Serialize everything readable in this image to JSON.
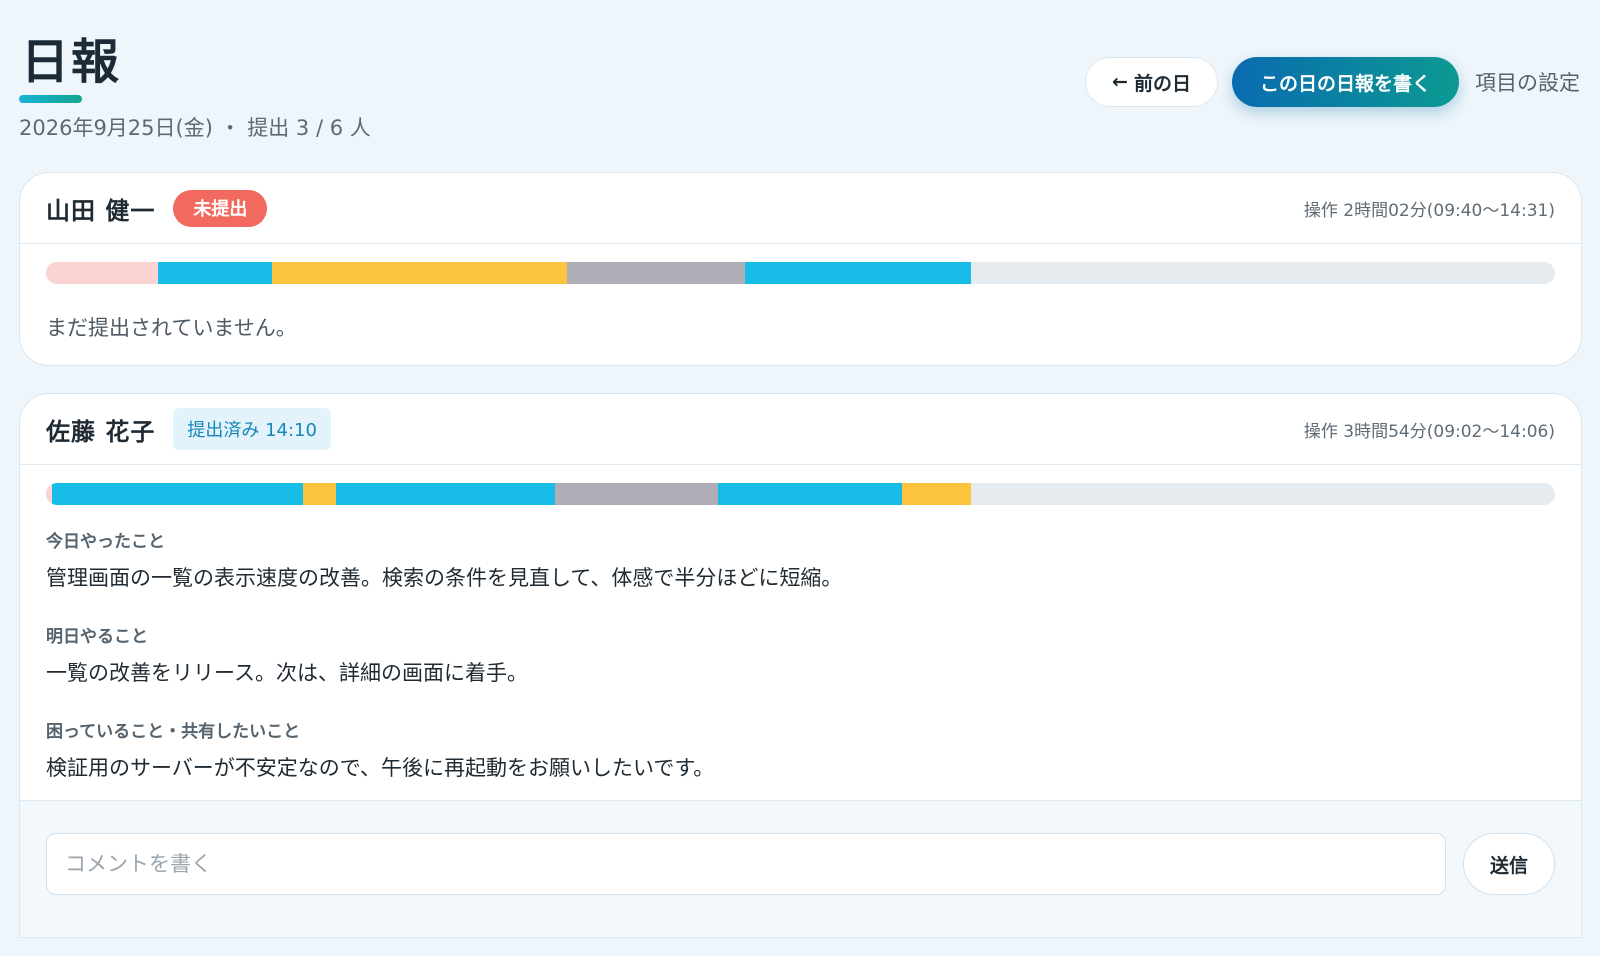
{
  "header": {
    "title": "日報",
    "subtitle": "2026年9月25日(金) ・ 提出 3 / 6 人",
    "prev_day_arrow": "←",
    "prev_day_label": "前の日",
    "write_report_label": "この日の日報を書く",
    "settings_label": "項目の設定",
    "accent_gradient": [
      "#17b3d6",
      "#12a58e"
    ]
  },
  "reports": [
    {
      "name": "山田 健一",
      "status_label": "未提出",
      "status_color": "#f26a5f",
      "operation_time": "操作 2時間02分(09:40〜14:31)",
      "activity_segments": [
        {
          "color": "#fbd3d0",
          "start": 0.0,
          "end": 0.074
        },
        {
          "color": "#17bde6",
          "start": 0.074,
          "end": 0.15
        },
        {
          "color": "#fcc43e",
          "start": 0.15,
          "end": 0.345
        },
        {
          "color": "#b0adb7",
          "start": 0.345,
          "end": 0.463
        },
        {
          "color": "#17bde6",
          "start": 0.463,
          "end": 0.613
        }
      ],
      "empty_message": "まだ提出されていません。"
    },
    {
      "name": "佐藤 花子",
      "status_label": "提出済み 14:10",
      "status_color": "#1686b8",
      "operation_time": "操作 3時間54分(09:02〜14:06)",
      "activity_segments": [
        {
          "color": "#fbd3d0",
          "start": 0.0,
          "end": 0.004
        },
        {
          "color": "#17bde6",
          "start": 0.004,
          "end": 0.17
        },
        {
          "color": "#fcc43e",
          "start": 0.17,
          "end": 0.192
        },
        {
          "color": "#17bde6",
          "start": 0.192,
          "end": 0.337
        },
        {
          "color": "#b0adb7",
          "start": 0.337,
          "end": 0.445
        },
        {
          "color": "#17bde6",
          "start": 0.445,
          "end": 0.567
        },
        {
          "color": "#fcc43e",
          "start": 0.567,
          "end": 0.613
        }
      ],
      "sections": [
        {
          "label": "今日やったこと",
          "text": "管理画面の一覧の表示速度の改善。検索の条件を見直して、体感で半分ほどに短縮。"
        },
        {
          "label": "明日やること",
          "text": "一覧の改善をリリース。次は、詳細の画面に着手。"
        },
        {
          "label": "困っていること・共有したいこと",
          "text": "検証用のサーバーが不安定なので、午後に再起動をお願いしたいです。"
        }
      ],
      "comment": {
        "placeholder": "コメントを書く",
        "value": "",
        "send_label": "送信"
      }
    }
  ]
}
